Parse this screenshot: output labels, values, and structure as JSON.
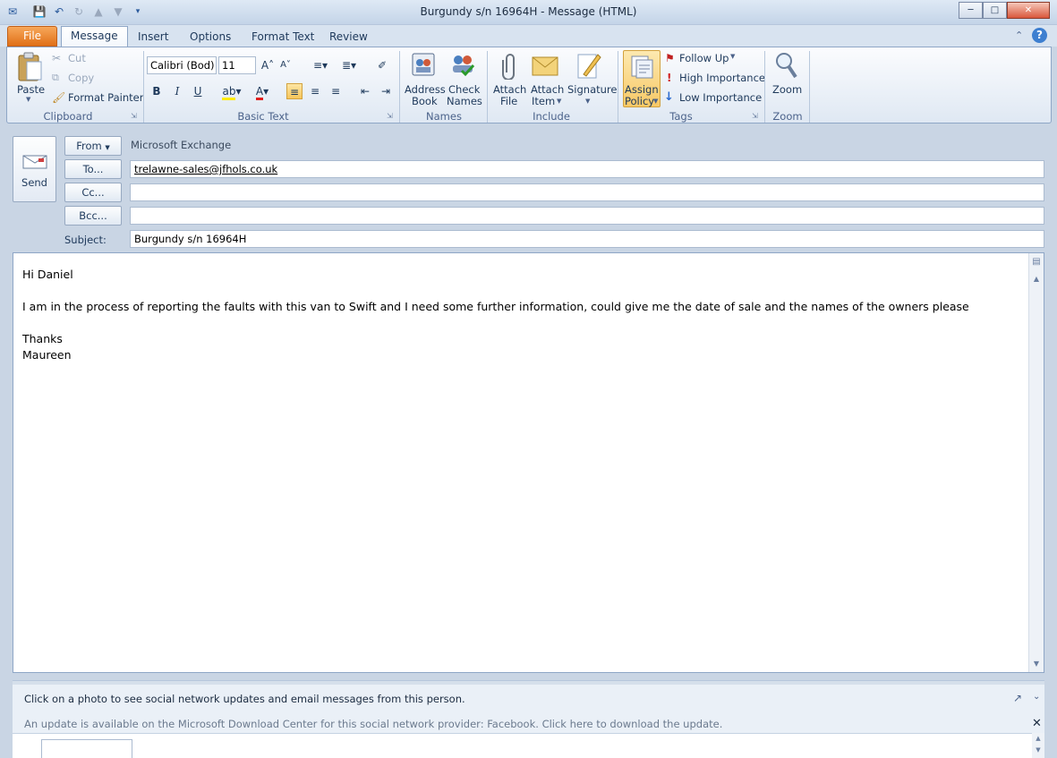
{
  "window": {
    "title": "Burgundy  s/n  16964H  -  Message (HTML)"
  },
  "tabs": {
    "file": "File",
    "items": [
      "Message",
      "Insert",
      "Options",
      "Format Text",
      "Review"
    ]
  },
  "ribbon": {
    "clipboard": {
      "paste": "Paste",
      "cut": "Cut",
      "copy": "Copy",
      "format_painter": "Format Painter",
      "group": "Clipboard"
    },
    "basic_text": {
      "font": "Calibri (Bod)",
      "size": "11",
      "group": "Basic Text"
    },
    "names": {
      "address_book_1": "Address",
      "address_book_2": "Book",
      "check_names_1": "Check",
      "check_names_2": "Names",
      "group": "Names"
    },
    "include": {
      "attach_file_1": "Attach",
      "attach_file_2": "File",
      "attach_item_1": "Attach",
      "attach_item_2": "Item",
      "signature": "Signature",
      "group": "Include"
    },
    "tags": {
      "assign_policy_1": "Assign",
      "assign_policy_2": "Policy",
      "follow_up": "Follow Up",
      "high_importance": "High Importance",
      "low_importance": "Low Importance",
      "group": "Tags"
    },
    "zoom": {
      "zoom": "Zoom",
      "group": "Zoom"
    }
  },
  "header": {
    "send": "Send",
    "from_button": "From",
    "from_value": "Microsoft Exchange",
    "to_button": "To...",
    "to_value": "trelawne-sales@jfhols.co.uk",
    "cc_button": "Cc...",
    "cc_value": "",
    "bcc_button": "Bcc...",
    "bcc_value": "",
    "subject_label": "Subject:",
    "subject_value": "Burgundy  s/n  16964H"
  },
  "body": {
    "greeting": "Hi Daniel",
    "paragraph": "I am in the process of reporting the faults with this van to Swift and I need some further information, could give me the date of sale and the names of the owners please",
    "closing": "Thanks",
    "signature": "Maureen"
  },
  "social": {
    "hint": "Click on a photo to see social network updates and email messages from this person.",
    "update_notice": "An update is available on the Microsoft Download Center for this social network provider: Facebook. Click here to download the update."
  },
  "colors": {
    "file_tab": "#e07018",
    "ribbon_bg": "#dfe8f3",
    "accent": "#1e395b",
    "selected_button": "#f6c55a"
  }
}
